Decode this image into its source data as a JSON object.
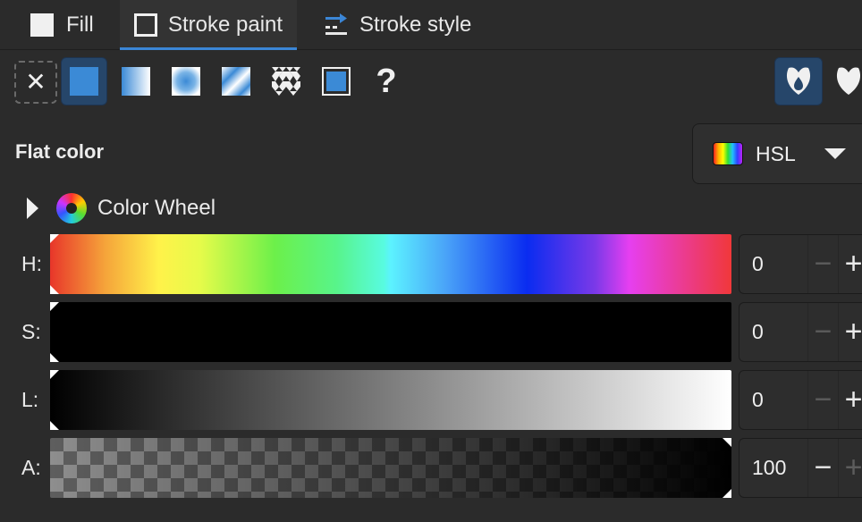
{
  "tabs": [
    {
      "label": "Fill",
      "icon": "fill-box-icon",
      "active": false
    },
    {
      "label": "Stroke paint",
      "icon": "stroke-box-icon",
      "active": true
    },
    {
      "label": "Stroke style",
      "icon": "stroke-style-icon",
      "active": false
    }
  ],
  "paint_types": [
    {
      "name": "no-paint",
      "icon": "close-icon",
      "selected": false
    },
    {
      "name": "flat-color",
      "icon": "flat-color-icon",
      "selected": true
    },
    {
      "name": "linear-gradient",
      "icon": "linear-gradient-icon",
      "selected": false
    },
    {
      "name": "radial-gradient",
      "icon": "radial-gradient-icon",
      "selected": false
    },
    {
      "name": "mesh-gradient",
      "icon": "mesh-gradient-icon",
      "selected": false
    },
    {
      "name": "pattern",
      "icon": "pattern-icon",
      "selected": false
    },
    {
      "name": "swatch",
      "icon": "swatch-icon",
      "selected": false
    },
    {
      "name": "unset",
      "label": "?",
      "selected": false
    }
  ],
  "fill_rules": [
    {
      "name": "evenodd",
      "icon": "fill-rule-evenodd-icon",
      "selected": true
    },
    {
      "name": "nonzero",
      "icon": "fill-rule-nonzero-icon",
      "selected": false
    }
  ],
  "section_title": "Flat color",
  "color_mode": {
    "label": "HSL",
    "icon": "rainbow-icon"
  },
  "color_wheel": {
    "label": "Color Wheel",
    "expanded": false
  },
  "sliders": [
    {
      "label": "H:",
      "value": "0"
    },
    {
      "label": "S:",
      "value": "0"
    },
    {
      "label": "L:",
      "value": "0"
    },
    {
      "label": "A:",
      "value": "100"
    }
  ],
  "colors": {
    "accent": "#3b86d6",
    "selected_bg": "#26466a",
    "panel_bg": "#2b2b2b",
    "current_color": "#000000"
  }
}
